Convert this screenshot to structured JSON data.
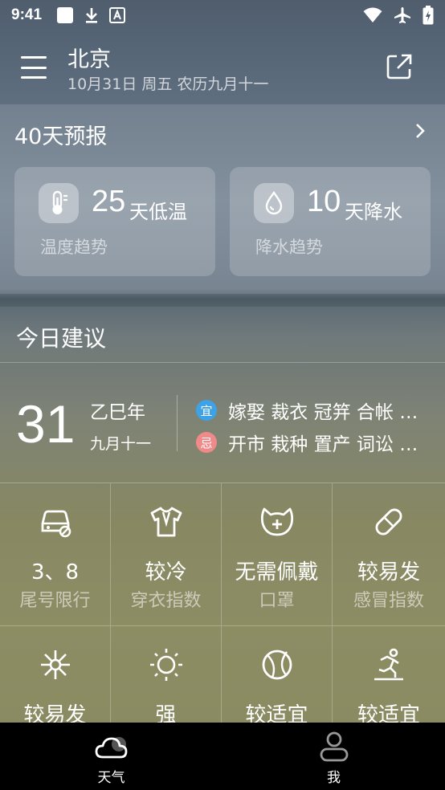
{
  "status_bar": {
    "time": "9:41",
    "left_icons": [
      "square-notification-icon",
      "download-icon",
      "font-a-icon"
    ],
    "right_icons": [
      "wifi-icon",
      "airplane-icon",
      "battery-charging-icon"
    ]
  },
  "header": {
    "city": "北京",
    "date_line": "10月31日 周五  农历九月十一"
  },
  "forecast": {
    "title": "40天预报",
    "cards": [
      {
        "number": "25",
        "unit": "天低温",
        "subtitle": "温度趋势",
        "icon": "thermometer-icon"
      },
      {
        "number": "10",
        "unit": "天降水",
        "subtitle": "降水趋势",
        "icon": "raindrop-icon"
      }
    ]
  },
  "advice": {
    "title": "今日建议",
    "calendar": {
      "day": "31",
      "year": "乙巳年",
      "lunar": "九月十一",
      "yi_badge": "宜",
      "yi_text": "嫁娶 裁衣 冠笄 合帐 …",
      "ji_badge": "忌",
      "ji_text": "开市 栽种 置产 词讼 …"
    },
    "indices": [
      {
        "value": "3、8",
        "label": "尾号限行",
        "icon": "car-icon"
      },
      {
        "value": "较冷",
        "label": "穿衣指数",
        "icon": "shirt-icon"
      },
      {
        "value": "无需佩戴",
        "label": "口罩",
        "icon": "mask-icon"
      },
      {
        "value": "较易发",
        "label": "感冒指数",
        "icon": "pill-icon"
      },
      {
        "value": "较易发",
        "label": "",
        "icon": "snowflake-icon"
      },
      {
        "value": "强",
        "label": "",
        "icon": "sun-icon"
      },
      {
        "value": "较适宜",
        "label": "",
        "icon": "ball-icon"
      },
      {
        "value": "较适宜",
        "label": "",
        "icon": "running-icon"
      }
    ]
  },
  "bottom_nav": {
    "items": [
      {
        "label": "天气",
        "icon": "cloud-icon",
        "active": true
      },
      {
        "label": "我",
        "icon": "person-icon",
        "active": false
      }
    ]
  }
}
